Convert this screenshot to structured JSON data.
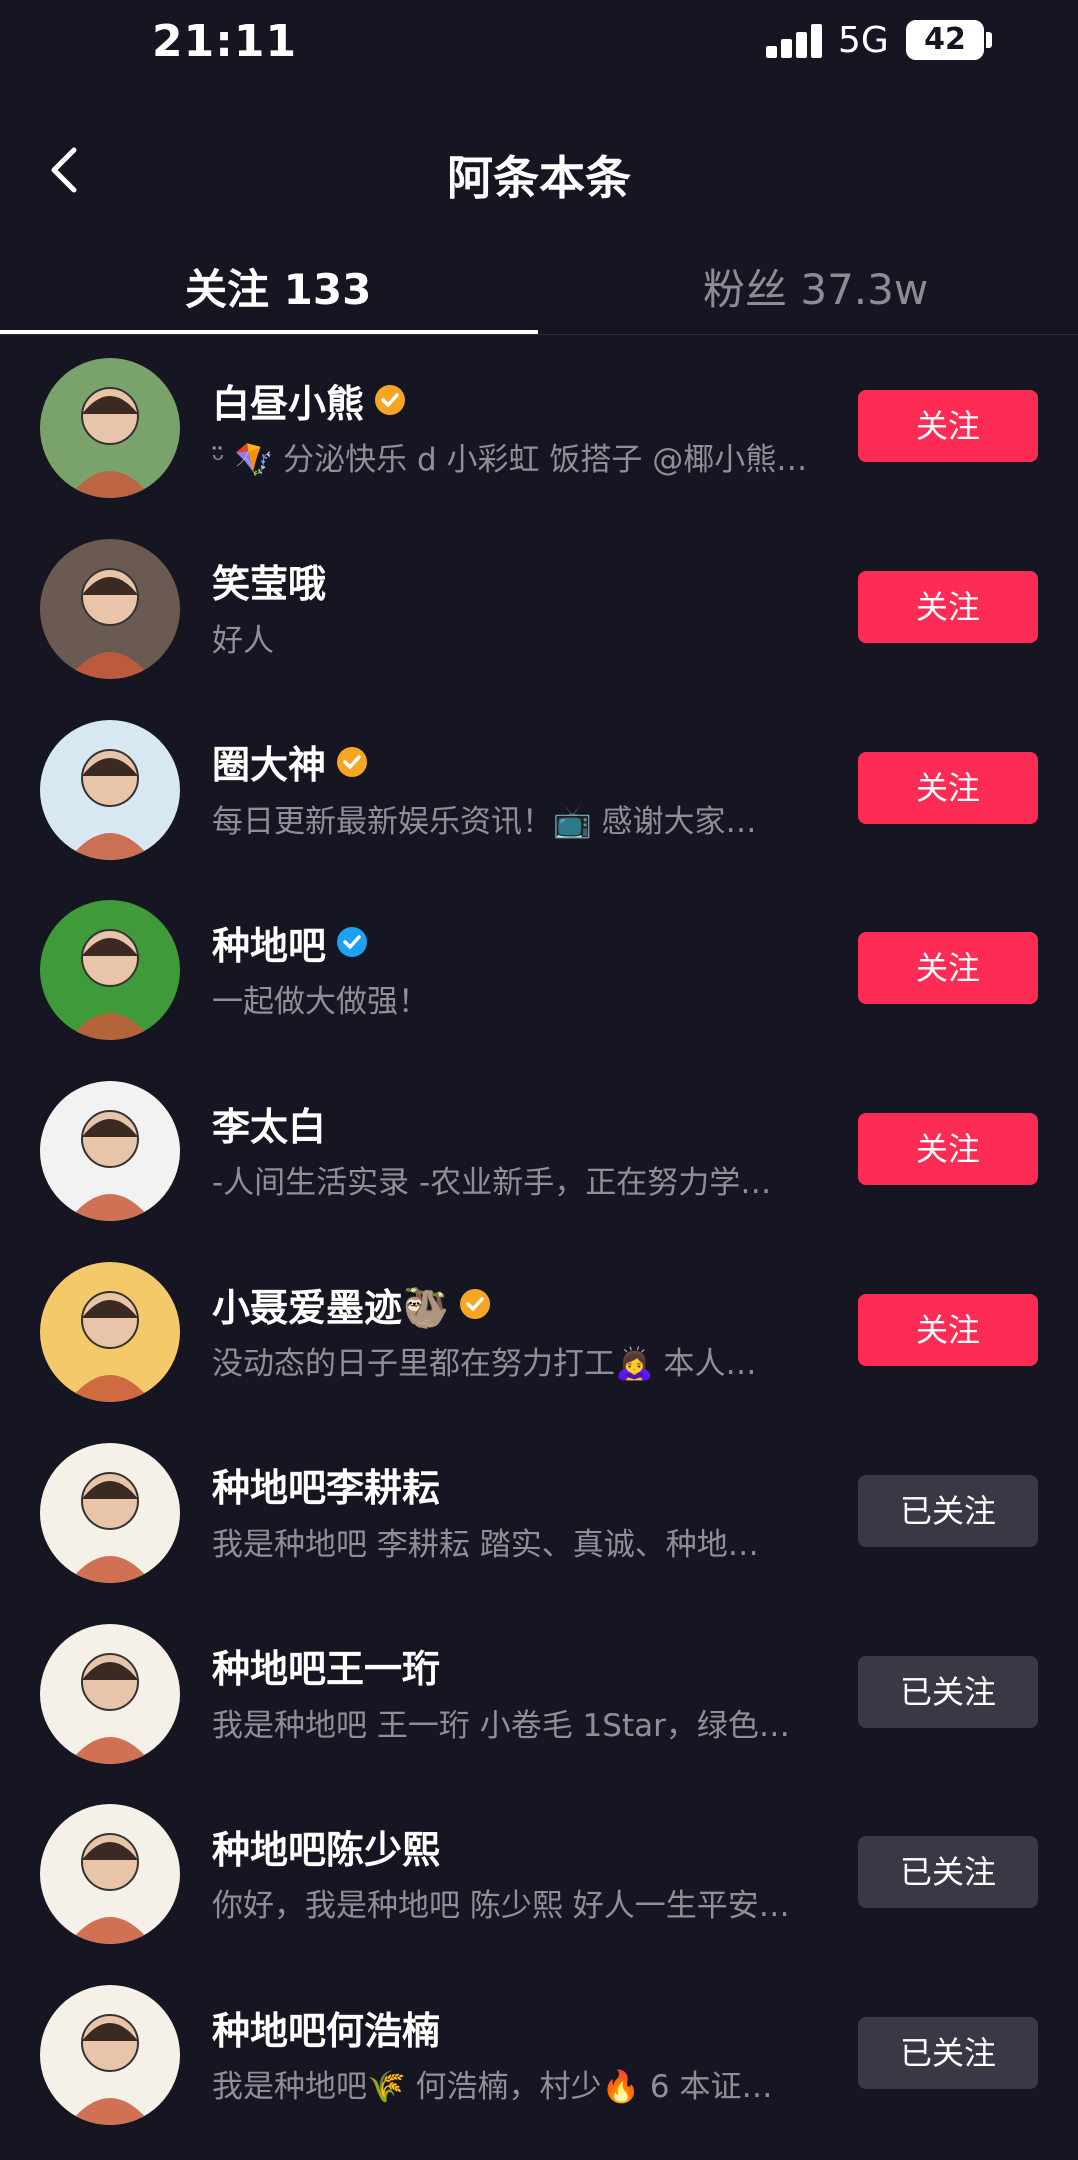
{
  "status_bar": {
    "time": "21:11",
    "network": "5G",
    "battery": "42"
  },
  "nav": {
    "title": "阿条本条"
  },
  "tabs": {
    "following": "关注 133",
    "fans": "粉丝 37.3w"
  },
  "users": [
    {
      "name": "白昼小熊",
      "badge": "gold",
      "desc": "ᵕ̈ 🪁 分泌快乐 d 小彩虹 饭搭子 @椰小熊…",
      "button": "关注",
      "followed": false,
      "avatar_color": "#7aa36b"
    },
    {
      "name": "笑莹哦",
      "badge": "",
      "desc": "好人",
      "button": "关注",
      "followed": false,
      "avatar_color": "#6b5a52"
    },
    {
      "name": "圈大神",
      "badge": "gold",
      "desc": "每日更新最新娱乐资讯！📺 感谢大家…",
      "button": "关注",
      "followed": false,
      "avatar_color": "#d8e8f2"
    },
    {
      "name": "种地吧",
      "badge": "blue",
      "desc": "一起做大做强！",
      "button": "关注",
      "followed": false,
      "avatar_color": "#3f9a3a"
    },
    {
      "name": "李太白",
      "badge": "",
      "desc": "-人间生活实录  -农业新手，正在努力学…",
      "button": "关注",
      "followed": false,
      "avatar_color": "#f2f2f2"
    },
    {
      "name": "小聂爱墨迹🦥",
      "badge": "gold",
      "desc": "没动态的日子里都在努力打工🙇‍♀️ 本人…",
      "button": "关注",
      "followed": false,
      "avatar_color": "#f4c96a"
    },
    {
      "name": "种地吧李耕耘",
      "badge": "",
      "desc": "我是种地吧 李耕耘  踏实、真诚、种地…",
      "button": "已关注",
      "followed": true,
      "avatar_color": "#f5f1e8"
    },
    {
      "name": "种地吧王一珩",
      "badge": "",
      "desc": "我是种地吧 王一珩 小卷毛 1Star，绿色…",
      "button": "已关注",
      "followed": true,
      "avatar_color": "#f5f1e8"
    },
    {
      "name": "种地吧陈少熙",
      "badge": "",
      "desc": "你好，我是种地吧 陈少熙 好人一生平安…",
      "button": "已关注",
      "followed": true,
      "avatar_color": "#f5f1e8"
    },
    {
      "name": "种地吧何浩楠",
      "badge": "",
      "desc": "我是种地吧🌾 何浩楠，村少🔥 6 本证…",
      "button": "已关注",
      "followed": true,
      "avatar_color": "#f5f1e8"
    }
  ],
  "colors": {
    "accent": "#fe2c55",
    "followed_bg": "#393945",
    "gold_badge": "#f5a623",
    "blue_badge": "#1da1f2",
    "background": "#161622"
  }
}
